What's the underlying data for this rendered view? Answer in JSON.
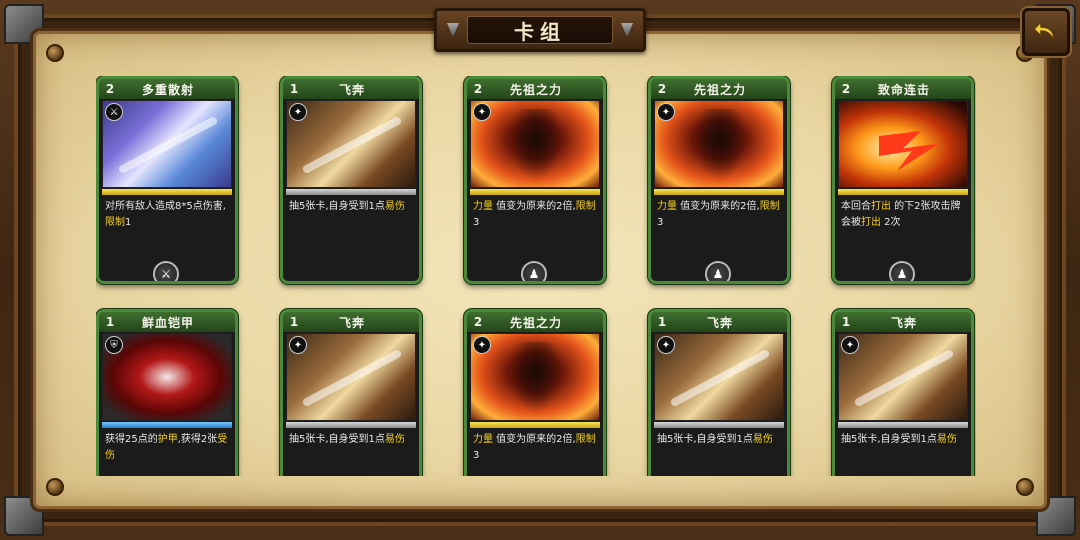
{
  "header": {
    "title": "卡组"
  },
  "colors": {
    "frame": "#3e2612",
    "parchment": "#ead7a3",
    "card_border": "#4a8a3a",
    "highlight_text": "#f5d020"
  },
  "icons": {
    "back": "back-arrow-icon"
  },
  "cards": [
    {
      "cost": "2",
      "name": "多重散射",
      "art": "multishot",
      "bar": "yellow",
      "desc_parts": [
        {
          "t": "对所有敌人造成8*5点伤害,",
          "hl": false
        },
        {
          "t": "限制",
          "hl": true
        },
        {
          "t": "1",
          "hl": false
        }
      ],
      "type_icon": "sword-icon",
      "badge_icon": "crossed-swords-icon"
    },
    {
      "cost": "1",
      "name": "飞奔",
      "art": "dash",
      "bar": "grey",
      "desc_parts": [
        {
          "t": "抽5张卡,自身受到1点",
          "hl": false
        },
        {
          "t": "易伤",
          "hl": true
        }
      ],
      "type_icon": "sparkle-icon",
      "badge_icon": ""
    },
    {
      "cost": "2",
      "name": "先祖之力",
      "art": "ancestor",
      "bar": "yellow",
      "desc_parts": [
        {
          "t": "力量",
          "hl": true
        },
        {
          "t": " 值变为原来的2倍,",
          "hl": false
        },
        {
          "t": "限制",
          "hl": true
        },
        {
          "t": " 3",
          "hl": false
        }
      ],
      "type_icon": "sparkle-icon",
      "badge_icon": "bell-icon"
    },
    {
      "cost": "2",
      "name": "先祖之力",
      "art": "ancestor",
      "bar": "yellow",
      "desc_parts": [
        {
          "t": "力量",
          "hl": true
        },
        {
          "t": " 值变为原来的2倍,",
          "hl": false
        },
        {
          "t": "限制",
          "hl": true
        },
        {
          "t": " 3",
          "hl": false
        }
      ],
      "type_icon": "sparkle-icon",
      "badge_icon": "bell-icon"
    },
    {
      "cost": "2",
      "name": "致命连击",
      "art": "fatal",
      "bar": "yellow",
      "desc_parts": [
        {
          "t": "本回合",
          "hl": false
        },
        {
          "t": "打出",
          "hl": true
        },
        {
          "t": " 的下2张攻击牌会被",
          "hl": false
        },
        {
          "t": "打出",
          "hl": true
        },
        {
          "t": " 2次",
          "hl": false
        }
      ],
      "type_icon": "",
      "badge_icon": "bell-icon"
    },
    {
      "cost": "1",
      "name": "鲜血铠甲",
      "art": "bloodarmor",
      "bar": "blue",
      "desc_parts": [
        {
          "t": "获得25点的",
          "hl": false
        },
        {
          "t": "护甲",
          "hl": true
        },
        {
          "t": ",获得2张",
          "hl": false
        },
        {
          "t": "受伤",
          "hl": true
        }
      ],
      "type_icon": "shield-icon",
      "badge_icon": ""
    },
    {
      "cost": "1",
      "name": "飞奔",
      "art": "dash",
      "bar": "grey",
      "desc_parts": [
        {
          "t": "抽5张卡,自身受到1点",
          "hl": false
        },
        {
          "t": "易伤",
          "hl": true
        }
      ],
      "type_icon": "sparkle-icon",
      "badge_icon": ""
    },
    {
      "cost": "2",
      "name": "先祖之力",
      "art": "ancestor",
      "bar": "yellow",
      "desc_parts": [
        {
          "t": "力量",
          "hl": true
        },
        {
          "t": " 值变为原来的2倍,",
          "hl": false
        },
        {
          "t": "限制",
          "hl": true
        },
        {
          "t": " 3",
          "hl": false
        }
      ],
      "type_icon": "sparkle-icon",
      "badge_icon": ""
    },
    {
      "cost": "1",
      "name": "飞奔",
      "art": "dash",
      "bar": "grey",
      "desc_parts": [
        {
          "t": "抽5张卡,自身受到1点",
          "hl": false
        },
        {
          "t": "易伤",
          "hl": true
        }
      ],
      "type_icon": "sparkle-icon",
      "badge_icon": ""
    },
    {
      "cost": "1",
      "name": "飞奔",
      "art": "dash",
      "bar": "grey",
      "desc_parts": [
        {
          "t": "抽5张卡,自身受到1点",
          "hl": false
        },
        {
          "t": "易伤",
          "hl": true
        }
      ],
      "type_icon": "sparkle-icon",
      "badge_icon": ""
    }
  ]
}
